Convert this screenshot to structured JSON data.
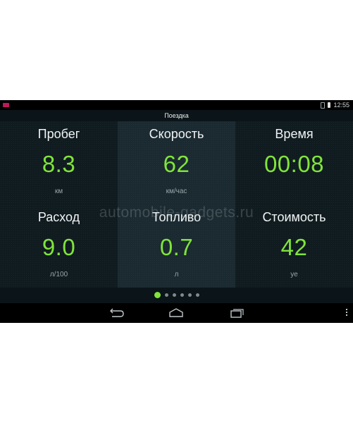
{
  "status_bar": {
    "time": "12:55"
  },
  "app_bar": {
    "title": "Поездка"
  },
  "tiles": [
    {
      "label": "Пробег",
      "value": "8.3",
      "unit": "км"
    },
    {
      "label": "Скорость",
      "value": "62",
      "unit": "км/час"
    },
    {
      "label": "Время",
      "value": "00:08",
      "unit": ""
    },
    {
      "label": "Расход",
      "value": "9.0",
      "unit": "л/100"
    },
    {
      "label": "Топливо",
      "value": "0.7",
      "unit": "л"
    },
    {
      "label": "Стоимость",
      "value": "42",
      "unit": "уе"
    }
  ],
  "watermark": "automobile-gadgets.ru",
  "pager": {
    "pages": 6,
    "active_index": 0
  },
  "navigation": {
    "icons": [
      "back-icon",
      "home-icon",
      "recent-apps-icon",
      "overflow-menu-icon"
    ]
  },
  "colors": {
    "accent_value": "#80e43a",
    "label": "#f1f4f5",
    "unit": "#9aa6aa",
    "background": "#0b1418",
    "tile_alt": "#1a2a30"
  }
}
